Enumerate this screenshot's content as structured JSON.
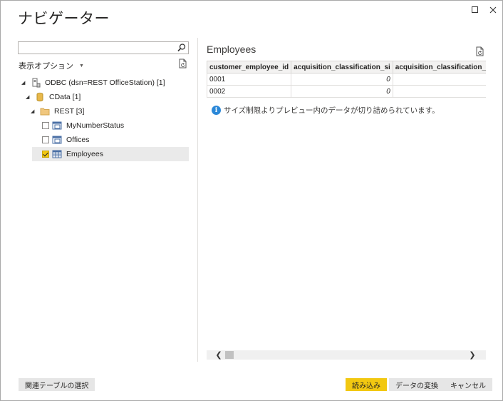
{
  "window": {
    "title": "ナビゲーター",
    "controls": [
      {
        "name": "maximize-icon",
        "glyph": "☐"
      },
      {
        "name": "close-icon",
        "glyph": "✕"
      }
    ]
  },
  "left": {
    "search": {
      "value": "",
      "placeholder": ""
    },
    "options_label": "表示オプション",
    "tree": [
      {
        "label": "ODBC (dsn=REST OfficeStation) [1]",
        "level": 0,
        "icon": "database-server-icon",
        "expanded": true,
        "checkbox": false
      },
      {
        "label": "CData [1]",
        "level": 1,
        "icon": "database-cylinder-icon",
        "expanded": true,
        "checkbox": false
      },
      {
        "label": "REST [3]",
        "level": 2,
        "icon": "folder-icon",
        "expanded": true,
        "checkbox": false
      },
      {
        "label": "MyNumberStatus",
        "level": 3,
        "icon": "view-icon",
        "checkbox": true,
        "checked": false
      },
      {
        "label": "Offices",
        "level": 3,
        "icon": "view-icon",
        "checkbox": true,
        "checked": false
      },
      {
        "label": "Employees",
        "level": 3,
        "icon": "table-icon",
        "checkbox": true,
        "checked": true,
        "selected": true
      }
    ]
  },
  "preview": {
    "title": "Employees",
    "columns": [
      "customer_employee_id",
      "acquisition_classification_si",
      "acquisition_classification_ui"
    ],
    "rows": [
      [
        "0001",
        "0",
        ""
      ],
      [
        "0002",
        "0",
        ""
      ]
    ],
    "info": "サイズ制限よりプレビュー内のデータが切り詰められています。"
  },
  "footer": {
    "related_tables": "関連テーブルの選択",
    "load": "読み込み",
    "transform": "データの変換",
    "cancel": "キャンセル"
  },
  "colors": {
    "accent": "#f2c811",
    "info": "#2b88d8",
    "selection": "#eaeaea"
  }
}
